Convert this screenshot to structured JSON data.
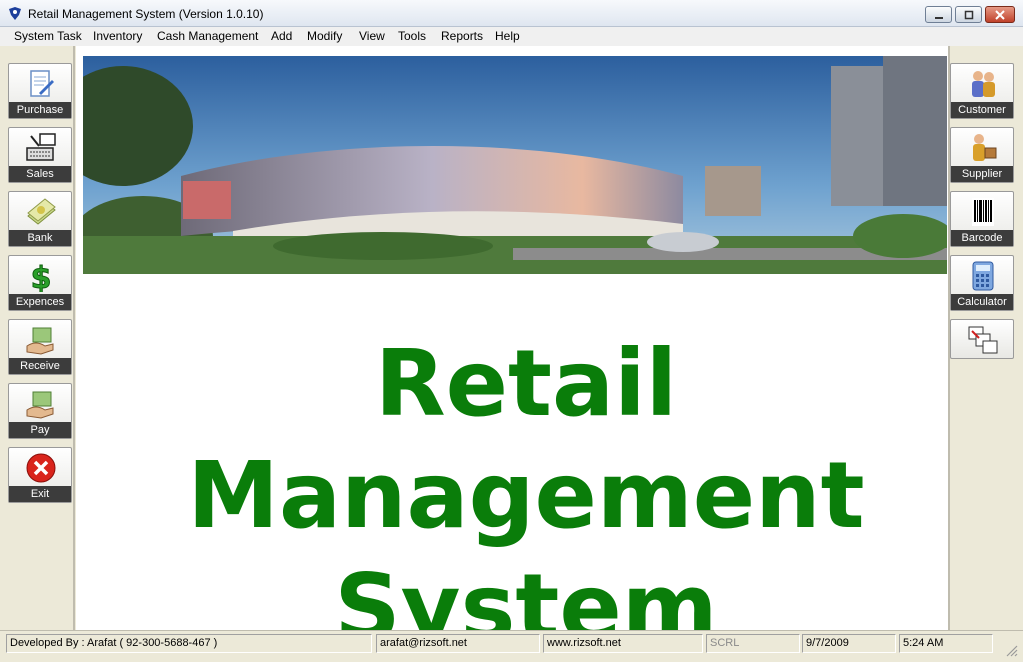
{
  "window": {
    "title": "Retail Management System (Version 1.0.10)"
  },
  "menu": [
    "System Task",
    "Inventory",
    "Cash Management",
    "Add",
    "Modify",
    "View",
    "Tools",
    "Reports",
    "Help"
  ],
  "left_toolbar": [
    {
      "label": "Purchase",
      "icon": "document-pen-icon"
    },
    {
      "label": "Sales",
      "icon": "keyboard-monitor-icon"
    },
    {
      "label": "Bank",
      "icon": "money-stack-icon"
    },
    {
      "label": "Expences",
      "icon": "dollar-sign-icon"
    },
    {
      "label": "Receive",
      "icon": "hand-money-icon"
    },
    {
      "label": "Pay",
      "icon": "hand-money-icon"
    },
    {
      "label": "Exit",
      "icon": "red-x-icon"
    }
  ],
  "right_toolbar": [
    {
      "label": "Customer",
      "icon": "people-icon"
    },
    {
      "label": "Supplier",
      "icon": "person-box-icon"
    },
    {
      "label": "Barcode",
      "icon": "barcode-icon"
    },
    {
      "label": "Calculator",
      "icon": "calculator-icon"
    },
    {
      "label": "",
      "icon": "windows-cascade-icon"
    }
  ],
  "main": {
    "title_lines": [
      "Retail",
      "Management",
      "System"
    ],
    "title_color": "#0a7d0a"
  },
  "statusbar": {
    "developer": "Developed By : Arafat ( 92-300-5688-467 )",
    "email": "arafat@rizsoft.net",
    "website": "www.rizsoft.net",
    "scroll": "SCRL",
    "date": "9/7/2009",
    "time": "5:24 AM"
  }
}
